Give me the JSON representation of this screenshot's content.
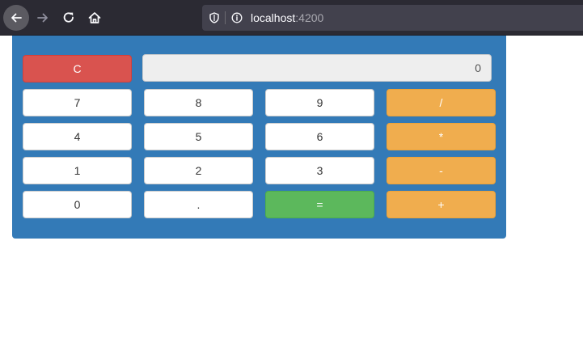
{
  "browser": {
    "url_host": "localhost",
    "url_port": ":4200"
  },
  "calculator": {
    "display_value": "0",
    "clear_label": "C",
    "keys": {
      "seven": "7",
      "eight": "8",
      "nine": "9",
      "divide": "/",
      "four": "4",
      "five": "5",
      "six": "6",
      "multiply": "*",
      "one": "1",
      "two": "2",
      "three": "3",
      "subtract": "-",
      "zero": "0",
      "decimal": ".",
      "equals": "=",
      "add": "+"
    }
  },
  "colors": {
    "panel": "#337ab7",
    "clear": "#d9534f",
    "operator": "#f0ad4e",
    "equals": "#5cb85c",
    "digit": "#ffffff",
    "display": "#eeeeee"
  }
}
